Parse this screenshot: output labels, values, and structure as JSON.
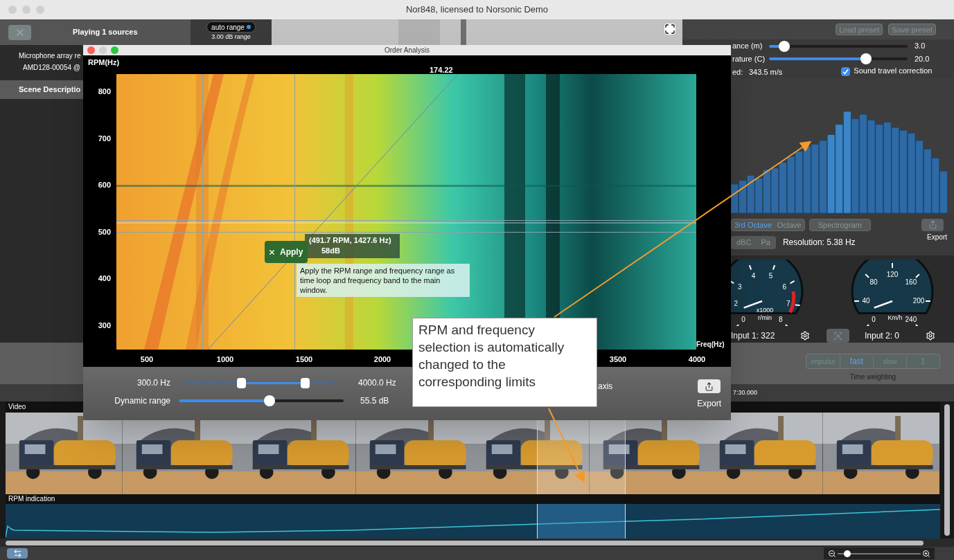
{
  "window": {
    "title": "Nor848, licensed to Norsonic Demo"
  },
  "left_panel": {
    "header": "Playing 1 sources",
    "info_lines": [
      "Microphone array re",
      "AMD128-00054 @"
    ],
    "section": "Scene Descriptio"
  },
  "video_view": {
    "kind": "picture",
    "range_mode": {
      "label": "auto range",
      "on": true
    },
    "range": "3.00 dB range"
  },
  "right_panel": {
    "buttons": [
      {
        "label": "Load preset",
        "disabled": true
      },
      {
        "label": "Save preset",
        "disabled": true
      }
    ],
    "sliders": [
      {
        "label": "ance (m)",
        "level": 0.11,
        "reading": "3.0"
      },
      {
        "label": "rature (C)",
        "level": 0.7,
        "reading": "20.0"
      }
    ],
    "speed": {
      "label": "ed:",
      "value": "343.5 m/s"
    },
    "sound_travel_correction": {
      "label": "Sound travel correction",
      "checked": true
    },
    "spectrum_tabs": [
      {
        "label": "3rd Octave",
        "selected": true
      },
      {
        "label": "Octave",
        "selected": false
      },
      {
        "label": "Spectrogram",
        "selected": false
      }
    ],
    "export_label": "Export",
    "units": [
      {
        "label": "dBC",
        "selected": false
      },
      {
        "label": "Pa",
        "selected": false
      }
    ],
    "resolution": "Resolution: 5.38 Hz",
    "gauges": [
      {
        "ticks": [
          "0",
          "2",
          "3",
          "4",
          "5",
          "6",
          "7",
          "8"
        ],
        "multiplier": "x1000",
        "unit": "r/min",
        "redline": true,
        "input": "Input 1: 322"
      },
      {
        "ticks": [
          "0",
          "40",
          "80",
          "120",
          "160",
          "200",
          "240"
        ],
        "unit": "Km/h",
        "redline": false,
        "input": "Input 2: 0"
      }
    ],
    "time_weighting": {
      "options": [
        {
          "label": "impulse",
          "selected": false
        },
        {
          "label": "fast",
          "selected": true
        },
        {
          "label": "slow",
          "selected": false
        },
        {
          "label": "Σ",
          "selected": false
        }
      ],
      "caption": "Time weighting"
    }
  },
  "timeline": {
    "time": "7:30.000",
    "zoom": {
      "level": 0.12
    }
  },
  "video_track": {
    "label": "Video"
  },
  "rpm_track": {
    "label": "RPM indication"
  },
  "order_analysis": {
    "title": "Order Analysis",
    "ylabel": "RPM(Hz)",
    "xlabel": "Freq(Hz)",
    "yticks": [
      "800",
      "700",
      "600",
      "500",
      "400",
      "300"
    ],
    "xticks": [
      "500",
      "1000",
      "1500",
      "2000",
      "3500",
      "4000"
    ],
    "line_label": "174.22",
    "cursor_readout": [
      "(491.7 RPM, 1427.6 Hz)",
      "58dB"
    ],
    "apply_button": "Apply",
    "apply_hint": "Apply the RPM range and frequency range as time loop and frequency band to the main window.",
    "frequency_range": {
      "low": "300.0 Hz",
      "high": "4000.0 Hz",
      "thumbs": [
        {
          "level": 0.37
        },
        {
          "level": 0.79
        }
      ]
    },
    "dynamic_range": {
      "label": "Dynamic range",
      "level": 0.55,
      "reading": "55.5 dB"
    },
    "axis_option": "axis",
    "export_label": "Export"
  },
  "callout": {
    "text": "RPM and frequency selection is automatically changed to the corresponding limits"
  }
}
